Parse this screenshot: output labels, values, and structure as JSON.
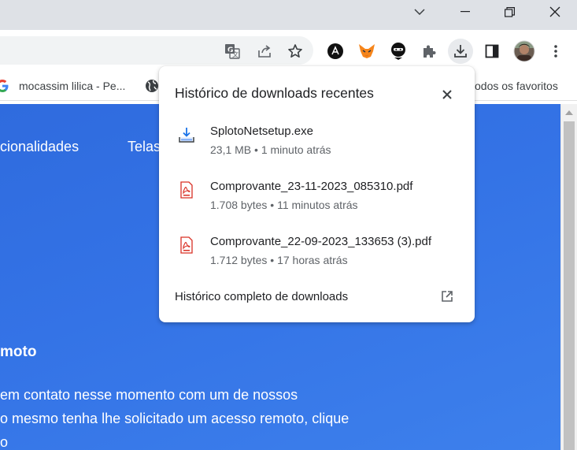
{
  "bookmarks": {
    "items": [
      {
        "label": "mocassim lilica - Pe...",
        "icon": "google-g-icon"
      },
      {
        "label": "",
        "icon": "globe-icon"
      },
      {
        "label": "odos os favoritos",
        "icon": ""
      }
    ]
  },
  "toolbar": {
    "extensions": [
      "translate-icon",
      "share-icon",
      "star-icon",
      "arc-extension-icon",
      "metamask-fox-icon",
      "ninja-extension-icon",
      "puzzle-extensions-icon",
      "download-icon",
      "side-panel-icon",
      "profile-avatar",
      "more-menu-icon"
    ]
  },
  "page": {
    "nav_1": "cionalidades",
    "nav_2": "Telas",
    "heading": "moto",
    "para_1": "em contato nesse momento com um de nossos",
    "para_2": "o mesmo tenha lhe solicitado um acesso remoto, clique",
    "para_3": "o"
  },
  "downloads": {
    "title": "Histórico de downloads recentes",
    "items": [
      {
        "name": "SplotoNetsetup.exe",
        "meta": "23,1 MB • 1 minuto atrás",
        "icon": "installer-icon"
      },
      {
        "name": "Comprovante_23-11-2023_085310.pdf",
        "meta": "1.708 bytes • 11 minutos atrás",
        "icon": "pdf-icon"
      },
      {
        "name": "Comprovante_22-09-2023_133653 (3).pdf",
        "meta": "1.712 bytes • 17 horas atrás",
        "icon": "pdf-icon"
      }
    ],
    "full_history": "Histórico completo de downloads"
  },
  "colors": {
    "page_blue": "#3473e6",
    "pdf_red": "#d93025",
    "metamask_orange": "#f6851b"
  }
}
